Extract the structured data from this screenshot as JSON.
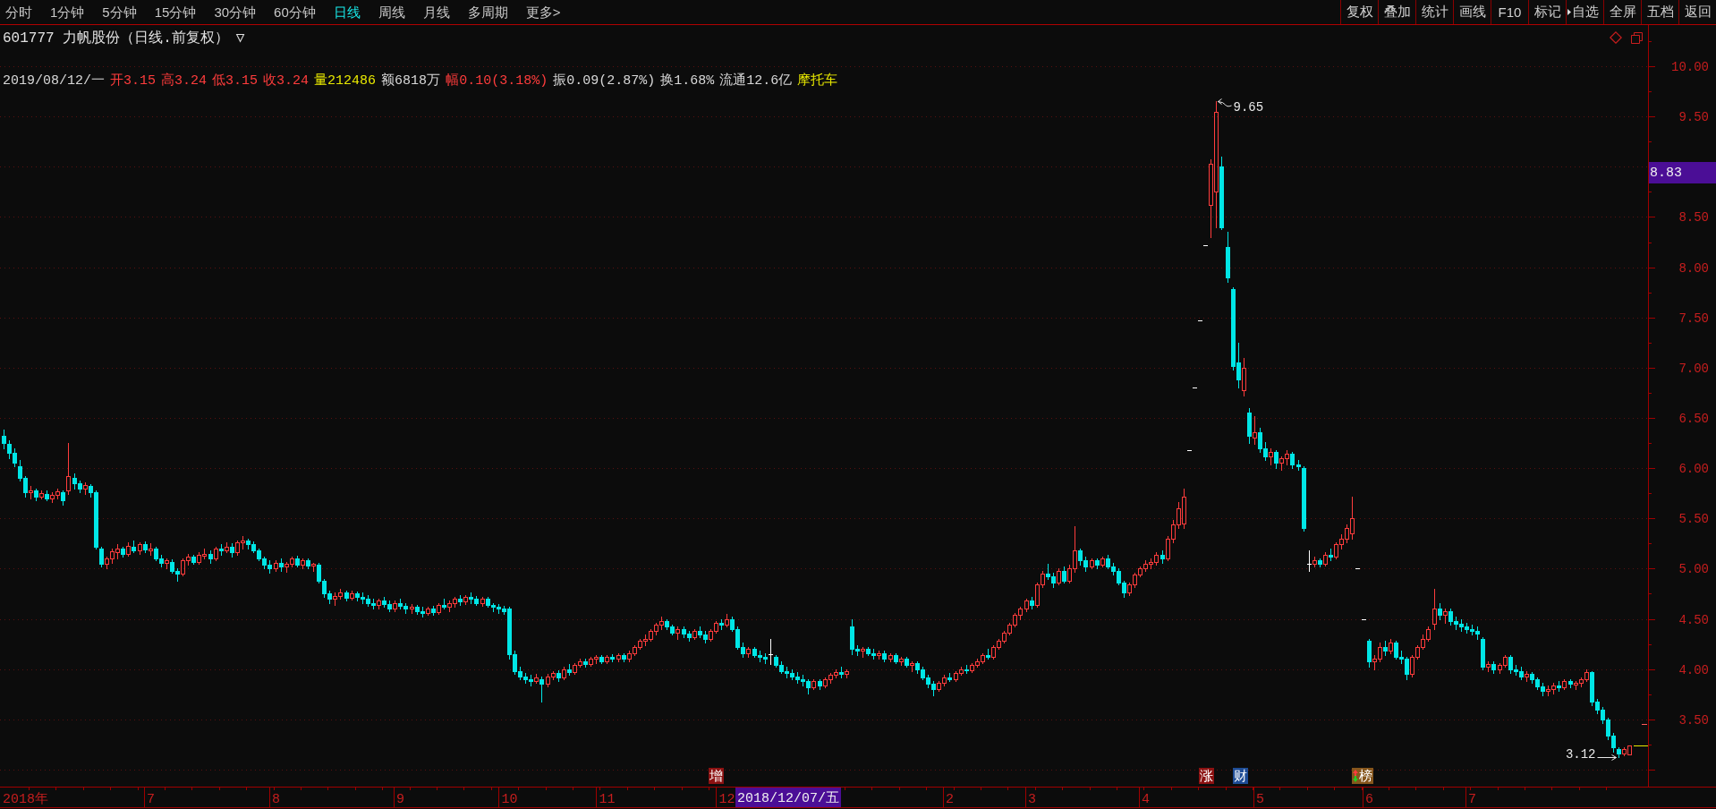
{
  "toolbar": {
    "period_tabs": [
      {
        "label": "分时",
        "selected": false
      },
      {
        "label": "1分钟",
        "selected": false
      },
      {
        "label": "5分钟",
        "selected": false
      },
      {
        "label": "15分钟",
        "selected": false
      },
      {
        "label": "30分钟",
        "selected": false
      },
      {
        "label": "60分钟",
        "selected": false
      },
      {
        "label": "日线",
        "selected": true
      },
      {
        "label": "周线",
        "selected": false
      },
      {
        "label": "月线",
        "selected": false
      },
      {
        "label": "多周期",
        "selected": false
      },
      {
        "label": "更多>",
        "selected": false
      }
    ],
    "buttons": [
      {
        "label": "复权",
        "kind": "plain"
      },
      {
        "label": "叠加",
        "kind": "plain"
      },
      {
        "label": "统计",
        "kind": "plain"
      },
      {
        "label": "画线",
        "kind": "plain"
      },
      {
        "label": "F10",
        "kind": "plain"
      },
      {
        "label": "标记",
        "kind": "plain"
      },
      {
        "label": "自选",
        "kind": "marked"
      },
      {
        "label": "全屏",
        "kind": "plain"
      },
      {
        "label": "五档",
        "kind": "plain"
      },
      {
        "label": "返回",
        "kind": "plain"
      }
    ]
  },
  "header": {
    "title": "601777 力帆股份（日线.前复权）",
    "dropdown": "▽"
  },
  "quote": [
    {
      "text": "2019/08/12/一",
      "color": "#d8d8d8"
    },
    {
      "text": "开3.15",
      "color": "#ff3c3c"
    },
    {
      "text": "高3.24",
      "color": "#ff3c3c"
    },
    {
      "text": "低3.15",
      "color": "#ff3c3c"
    },
    {
      "text": "收3.24",
      "color": "#ff3c3c"
    },
    {
      "text": "量212486",
      "color": "#e8e800"
    },
    {
      "text": "额6818万",
      "color": "#d8d8d8"
    },
    {
      "text": "幅0.10(3.18%)",
      "color": "#ff3c3c"
    },
    {
      "text": "振0.09(2.87%)",
      "color": "#d8d8d8"
    },
    {
      "text": "换1.68%",
      "color": "#d8d8d8"
    },
    {
      "text": "流通12.6亿",
      "color": "#d8d8d8"
    },
    {
      "text": "摩托车",
      "color": "#e8e800"
    }
  ],
  "chart": {
    "high_label": "9.65",
    "low_label": "3.12",
    "price_readout": "8.83",
    "date_readout": "2018/12/07/五",
    "events": [
      {
        "text": "增",
        "kind": "plain",
        "color": "#8c1212"
      },
      {
        "text": "涨",
        "kind": "plain",
        "color": "#8c1212"
      },
      {
        "text": "财",
        "kind": "plain",
        "color": "#1e4c96"
      },
      {
        "text": "榜",
        "kind": "arrows",
        "color": "#86561c"
      }
    ],
    "chart_data": {
      "type": "candlestick",
      "grid": true,
      "ylim": [
        2.83,
        10.41
      ],
      "yticks": [
        {
          "value": 10,
          "label": "10.00"
        },
        {
          "value": 9.5,
          "label": "9.50"
        },
        {
          "value": 8.5,
          "label": "8.50"
        },
        {
          "value": 8,
          "label": "8.00"
        },
        {
          "value": 7.5,
          "label": "7.50"
        },
        {
          "value": 7,
          "label": "7.00"
        },
        {
          "value": 6.5,
          "label": "6.50"
        },
        {
          "value": 6,
          "label": "6.00"
        },
        {
          "value": 5.5,
          "label": "5.50"
        },
        {
          "value": 5,
          "label": "5.00"
        },
        {
          "value": 4.5,
          "label": "4.50"
        },
        {
          "value": 4,
          "label": "4.00"
        },
        {
          "value": 3.5,
          "label": "3.50"
        }
      ],
      "categories": [
        null,
        null,
        null,
        null,
        "2018年",
        null,
        null,
        null,
        null,
        null,
        null,
        null,
        null,
        null,
        null,
        null,
        null,
        null,
        null,
        null,
        null,
        null,
        null,
        null,
        null,
        null,
        null,
        "7",
        null,
        null,
        null,
        null,
        null,
        null,
        null,
        null,
        null,
        null,
        null,
        null,
        null,
        null,
        null,
        null,
        null,
        null,
        null,
        null,
        null,
        null,
        "8",
        null,
        null,
        null,
        null,
        null,
        null,
        null,
        null,
        null,
        null,
        null,
        null,
        null,
        null,
        null,
        null,
        null,
        null,
        null,
        null,
        null,
        null,
        "9",
        null,
        null,
        null,
        null,
        null,
        null,
        null,
        null,
        null,
        null,
        null,
        null,
        null,
        null,
        null,
        null,
        null,
        null,
        null,
        "10",
        null,
        null,
        null,
        null,
        null,
        null,
        null,
        null,
        null,
        null,
        null,
        null,
        null,
        null,
        null,
        null,
        null,
        "11",
        null,
        null,
        null,
        null,
        null,
        null,
        null,
        null,
        null,
        null,
        null,
        null,
        null,
        null,
        null,
        null,
        null,
        null,
        null,
        null,
        null,
        "12",
        null,
        null,
        null,
        null,
        null,
        null,
        null,
        null,
        null,
        null,
        null,
        null,
        null,
        null,
        null,
        null,
        null,
        null,
        null,
        null,
        null,
        null,
        null,
        null,
        null,
        null,
        null,
        null,
        null,
        null,
        null,
        null,
        null,
        null,
        null,
        null,
        null,
        null,
        null,
        null,
        "2",
        null,
        null,
        null,
        null,
        null,
        null,
        null,
        null,
        null,
        null,
        null,
        null,
        null,
        null,
        "3",
        null,
        null,
        null,
        null,
        null,
        null,
        null,
        null,
        null,
        null,
        null,
        null,
        null,
        null,
        null,
        null,
        null,
        null,
        null,
        null,
        "4",
        null,
        null,
        null,
        null,
        null,
        null,
        null,
        null,
        null,
        null,
        null,
        null,
        null,
        null,
        null,
        null,
        null,
        null,
        null,
        null,
        "5",
        null,
        null,
        null,
        null,
        null,
        null,
        null,
        null,
        null,
        null,
        null,
        null,
        null,
        null,
        null,
        null,
        null,
        null,
        null,
        "6",
        null,
        null,
        null,
        null,
        null,
        null,
        null,
        null,
        null,
        null,
        null,
        null,
        null,
        null,
        null,
        null,
        null,
        null,
        "7",
        null,
        null,
        null,
        null,
        null,
        null,
        null,
        null,
        null,
        null,
        null,
        null,
        null,
        null,
        null,
        null,
        null,
        null,
        null,
        null,
        null,
        null,
        null,
        null,
        null,
        null,
        null,
        null,
        null
      ],
      "ohlc": [
        [
          6.32,
          6.38,
          6.2,
          6.25
        ],
        [
          6.24,
          6.28,
          6.1,
          6.15
        ],
        [
          6.15,
          6.2,
          6.02,
          6.05
        ],
        [
          6.02,
          6.08,
          5.88,
          5.9
        ],
        [
          5.9,
          5.92,
          5.72,
          5.76
        ],
        [
          5.76,
          5.82,
          5.7,
          5.78
        ],
        [
          5.78,
          5.8,
          5.68,
          5.72
        ],
        [
          5.72,
          5.78,
          5.7,
          5.75
        ],
        [
          5.74,
          5.78,
          5.68,
          5.7
        ],
        [
          5.7,
          5.76,
          5.66,
          5.73
        ],
        [
          5.73,
          5.8,
          5.7,
          5.77
        ],
        [
          5.76,
          5.78,
          5.64,
          5.68
        ],
        [
          5.78,
          6.25,
          5.74,
          5.92
        ],
        [
          5.9,
          5.95,
          5.8,
          5.85
        ],
        [
          5.85,
          5.88,
          5.76,
          5.8
        ],
        [
          5.8,
          5.86,
          5.74,
          5.83
        ],
        [
          5.82,
          5.84,
          5.72,
          5.76
        ],
        [
          5.76,
          5.78,
          5.2,
          5.22
        ],
        [
          5.2,
          5.22,
          5.02,
          5.05
        ],
        [
          5.05,
          5.12,
          5.0,
          5.1
        ],
        [
          5.1,
          5.2,
          5.06,
          5.17
        ],
        [
          5.16,
          5.24,
          5.1,
          5.2
        ],
        [
          5.2,
          5.22,
          5.12,
          5.15
        ],
        [
          5.15,
          5.26,
          5.13,
          5.23
        ],
        [
          5.22,
          5.28,
          5.16,
          5.18
        ],
        [
          5.18,
          5.26,
          5.15,
          5.24
        ],
        [
          5.24,
          5.27,
          5.16,
          5.19
        ],
        [
          5.19,
          5.25,
          5.14,
          5.2
        ],
        [
          5.2,
          5.22,
          5.08,
          5.1
        ],
        [
          5.1,
          5.14,
          5.02,
          5.06
        ],
        [
          5.06,
          5.1,
          5.0,
          5.08
        ],
        [
          5.07,
          5.09,
          4.96,
          4.98
        ],
        [
          4.98,
          5.0,
          4.88,
          4.95
        ],
        [
          4.95,
          5.1,
          4.93,
          5.08
        ],
        [
          5.08,
          5.15,
          5.04,
          5.12
        ],
        [
          5.12,
          5.14,
          5.05,
          5.07
        ],
        [
          5.07,
          5.16,
          5.05,
          5.14
        ],
        [
          5.14,
          5.2,
          5.1,
          5.15
        ],
        [
          5.15,
          5.18,
          5.06,
          5.1
        ],
        [
          5.1,
          5.22,
          5.08,
          5.2
        ],
        [
          5.2,
          5.24,
          5.14,
          5.18
        ],
        [
          5.18,
          5.26,
          5.16,
          5.22
        ],
        [
          5.22,
          5.25,
          5.12,
          5.16
        ],
        [
          5.16,
          5.28,
          5.14,
          5.26
        ],
        [
          5.26,
          5.32,
          5.2,
          5.28
        ],
        [
          5.28,
          5.3,
          5.2,
          5.24
        ],
        [
          5.24,
          5.27,
          5.16,
          5.18
        ],
        [
          5.18,
          5.2,
          5.08,
          5.1
        ],
        [
          5.1,
          5.12,
          5.0,
          5.04
        ],
        [
          5.04,
          5.08,
          4.96,
          5.0
        ],
        [
          5.0,
          5.08,
          4.98,
          5.06
        ],
        [
          5.06,
          5.1,
          4.98,
          5.02
        ],
        [
          5.02,
          5.07,
          4.97,
          5.05
        ],
        [
          5.05,
          5.12,
          5.02,
          5.1
        ],
        [
          5.1,
          5.13,
          5.02,
          5.04
        ],
        [
          5.04,
          5.1,
          5.0,
          5.08
        ],
        [
          5.08,
          5.1,
          5.0,
          5.03
        ],
        [
          5.03,
          5.06,
          4.98,
          5.05
        ],
        [
          5.04,
          5.06,
          4.86,
          4.88
        ],
        [
          4.88,
          4.9,
          4.72,
          4.75
        ],
        [
          4.75,
          4.78,
          4.66,
          4.7
        ],
        [
          4.7,
          4.76,
          4.64,
          4.73
        ],
        [
          4.73,
          4.8,
          4.7,
          4.76
        ],
        [
          4.76,
          4.78,
          4.68,
          4.71
        ],
        [
          4.71,
          4.78,
          4.69,
          4.75
        ],
        [
          4.75,
          4.77,
          4.68,
          4.72
        ],
        [
          4.72,
          4.76,
          4.66,
          4.7
        ],
        [
          4.7,
          4.74,
          4.63,
          4.66
        ],
        [
          4.66,
          4.7,
          4.6,
          4.64
        ],
        [
          4.64,
          4.7,
          4.6,
          4.68
        ],
        [
          4.68,
          4.72,
          4.62,
          4.65
        ],
        [
          4.65,
          4.68,
          4.58,
          4.6
        ],
        [
          4.6,
          4.68,
          4.58,
          4.66
        ],
        [
          4.66,
          4.7,
          4.6,
          4.63
        ],
        [
          4.63,
          4.66,
          4.56,
          4.6
        ],
        [
          4.6,
          4.65,
          4.56,
          4.62
        ],
        [
          4.62,
          4.64,
          4.55,
          4.58
        ],
        [
          4.58,
          4.62,
          4.52,
          4.56
        ],
        [
          4.56,
          4.62,
          4.54,
          4.6
        ],
        [
          4.6,
          4.63,
          4.54,
          4.57
        ],
        [
          4.57,
          4.66,
          4.55,
          4.64
        ],
        [
          4.64,
          4.7,
          4.6,
          4.62
        ],
        [
          4.62,
          4.68,
          4.58,
          4.66
        ],
        [
          4.66,
          4.72,
          4.62,
          4.7
        ],
        [
          4.7,
          4.74,
          4.64,
          4.67
        ],
        [
          4.67,
          4.74,
          4.65,
          4.72
        ],
        [
          4.72,
          4.76,
          4.66,
          4.7
        ],
        [
          4.7,
          4.73,
          4.64,
          4.66
        ],
        [
          4.66,
          4.72,
          4.63,
          4.7
        ],
        [
          4.7,
          4.72,
          4.62,
          4.64
        ],
        [
          4.64,
          4.66,
          4.58,
          4.62
        ],
        [
          4.62,
          4.65,
          4.56,
          4.6
        ],
        [
          4.6,
          4.63,
          4.55,
          4.58
        ],
        [
          4.6,
          4.62,
          4.1,
          4.15
        ],
        [
          4.15,
          4.18,
          3.95,
          3.98
        ],
        [
          3.98,
          4.02,
          3.9,
          3.93
        ],
        [
          3.93,
          3.96,
          3.86,
          3.9
        ],
        [
          3.9,
          3.94,
          3.84,
          3.88
        ],
        [
          3.88,
          3.95,
          3.86,
          3.92
        ],
        [
          3.9,
          3.93,
          3.68,
          3.85
        ],
        [
          3.85,
          3.95,
          3.83,
          3.93
        ],
        [
          3.93,
          3.98,
          3.9,
          3.96
        ],
        [
          3.96,
          3.99,
          3.88,
          3.92
        ],
        [
          3.92,
          4.02,
          3.9,
          4.0
        ],
        [
          4.0,
          4.05,
          3.94,
          3.97
        ],
        [
          3.97,
          4.06,
          3.95,
          4.04
        ],
        [
          4.04,
          4.1,
          4.02,
          4.08
        ],
        [
          4.08,
          4.1,
          4.02,
          4.05
        ],
        [
          4.05,
          4.12,
          4.03,
          4.1
        ],
        [
          4.1,
          4.14,
          4.06,
          4.12
        ],
        [
          4.12,
          4.14,
          4.06,
          4.08
        ],
        [
          4.08,
          4.14,
          4.06,
          4.12
        ],
        [
          4.12,
          4.15,
          4.08,
          4.1
        ],
        [
          4.1,
          4.16,
          4.08,
          4.14
        ],
        [
          4.14,
          4.16,
          4.08,
          4.1
        ],
        [
          4.1,
          4.18,
          4.08,
          4.16
        ],
        [
          4.16,
          4.24,
          4.14,
          4.22
        ],
        [
          4.22,
          4.3,
          4.2,
          4.28
        ],
        [
          4.28,
          4.34,
          4.24,
          4.3
        ],
        [
          4.3,
          4.4,
          4.28,
          4.38
        ],
        [
          4.38,
          4.46,
          4.34,
          4.44
        ],
        [
          4.44,
          4.52,
          4.4,
          4.48
        ],
        [
          4.48,
          4.5,
          4.4,
          4.42
        ],
        [
          4.42,
          4.44,
          4.34,
          4.36
        ],
        [
          4.36,
          4.42,
          4.3,
          4.4
        ],
        [
          4.4,
          4.42,
          4.32,
          4.35
        ],
        [
          4.35,
          4.38,
          4.28,
          4.32
        ],
        [
          4.32,
          4.4,
          4.3,
          4.38
        ],
        [
          4.38,
          4.42,
          4.32,
          4.34
        ],
        [
          4.34,
          4.38,
          4.26,
          4.3
        ],
        [
          4.3,
          4.4,
          4.28,
          4.38
        ],
        [
          4.38,
          4.48,
          4.36,
          4.46
        ],
        [
          4.46,
          4.5,
          4.4,
          4.44
        ],
        [
          4.44,
          4.55,
          4.42,
          4.5
        ],
        [
          4.5,
          4.52,
          4.38,
          4.4
        ],
        [
          4.4,
          4.42,
          4.2,
          4.22
        ],
        [
          4.22,
          4.26,
          4.12,
          4.16
        ],
        [
          4.16,
          4.22,
          4.12,
          4.2
        ],
        [
          4.2,
          4.22,
          4.12,
          4.14
        ],
        [
          4.14,
          4.18,
          4.08,
          4.12
        ],
        [
          4.12,
          4.16,
          4.06,
          4.1
        ],
        [
          4.15,
          4.3,
          4.05,
          4.15
        ],
        [
          4.12,
          4.14,
          4.02,
          4.04
        ],
        [
          4.04,
          4.08,
          3.96,
          3.98
        ],
        [
          3.98,
          4.02,
          3.92,
          3.96
        ],
        [
          3.96,
          4.0,
          3.9,
          3.93
        ],
        [
          3.93,
          3.97,
          3.86,
          3.9
        ],
        [
          3.9,
          3.94,
          3.84,
          3.88
        ],
        [
          3.88,
          3.9,
          3.76,
          3.82
        ],
        [
          3.82,
          3.9,
          3.8,
          3.88
        ],
        [
          3.88,
          3.9,
          3.8,
          3.84
        ],
        [
          3.84,
          3.92,
          3.82,
          3.9
        ],
        [
          3.9,
          3.96,
          3.86,
          3.94
        ],
        [
          3.94,
          4.0,
          3.92,
          3.97
        ],
        [
          3.97,
          4.02,
          3.92,
          3.95
        ],
        [
          3.95,
          4.0,
          3.92,
          3.98
        ],
        [
          4.42,
          4.5,
          4.15,
          4.2
        ],
        [
          4.2,
          4.24,
          4.14,
          4.18
        ],
        [
          4.18,
          4.22,
          4.12,
          4.2
        ],
        [
          4.2,
          4.22,
          4.14,
          4.16
        ],
        [
          4.16,
          4.2,
          4.1,
          4.14
        ],
        [
          4.14,
          4.18,
          4.1,
          4.16
        ],
        [
          4.16,
          4.18,
          4.08,
          4.1
        ],
        [
          4.1,
          4.16,
          4.08,
          4.14
        ],
        [
          4.14,
          4.16,
          4.06,
          4.08
        ],
        [
          4.08,
          4.12,
          4.04,
          4.1
        ],
        [
          4.1,
          4.12,
          4.02,
          4.04
        ],
        [
          4.04,
          4.08,
          3.98,
          4.06
        ],
        [
          4.06,
          4.08,
          3.96,
          4.0
        ],
        [
          4.0,
          4.02,
          3.9,
          3.92
        ],
        [
          3.92,
          3.94,
          3.82,
          3.85
        ],
        [
          3.85,
          3.88,
          3.74,
          3.8
        ],
        [
          3.8,
          3.88,
          3.78,
          3.86
        ],
        [
          3.86,
          3.94,
          3.84,
          3.92
        ],
        [
          3.92,
          3.96,
          3.88,
          3.9
        ],
        [
          3.9,
          3.98,
          3.88,
          3.96
        ],
        [
          3.96,
          4.02,
          3.94,
          4.0
        ],
        [
          4.0,
          4.04,
          3.96,
          3.99
        ],
        [
          3.99,
          4.06,
          3.97,
          4.04
        ],
        [
          4.04,
          4.1,
          4.02,
          4.08
        ],
        [
          4.08,
          4.16,
          4.06,
          4.14
        ],
        [
          4.14,
          4.2,
          4.1,
          4.12
        ],
        [
          4.12,
          4.24,
          4.1,
          4.22
        ],
        [
          4.22,
          4.3,
          4.2,
          4.28
        ],
        [
          4.28,
          4.38,
          4.26,
          4.36
        ],
        [
          4.36,
          4.46,
          4.34,
          4.44
        ],
        [
          4.44,
          4.56,
          4.42,
          4.54
        ],
        [
          4.54,
          4.62,
          4.5,
          4.6
        ],
        [
          4.6,
          4.7,
          4.58,
          4.68
        ],
        [
          4.68,
          4.72,
          4.6,
          4.64
        ],
        [
          4.64,
          4.86,
          4.62,
          4.84
        ],
        [
          4.84,
          4.98,
          4.82,
          4.95
        ],
        [
          4.95,
          5.05,
          4.9,
          4.92
        ],
        [
          4.92,
          4.96,
          4.82,
          4.86
        ],
        [
          4.86,
          5.0,
          4.84,
          4.98
        ],
        [
          4.98,
          5.02,
          4.86,
          4.88
        ],
        [
          4.88,
          5.04,
          4.86,
          5.0
        ],
        [
          5.0,
          5.42,
          4.97,
          5.18
        ],
        [
          5.18,
          5.2,
          5.04,
          5.08
        ],
        [
          5.08,
          5.12,
          4.98,
          5.02
        ],
        [
          5.02,
          5.1,
          5.0,
          5.08
        ],
        [
          5.08,
          5.1,
          5.0,
          5.04
        ],
        [
          5.04,
          5.12,
          5.02,
          5.1
        ],
        [
          5.1,
          5.14,
          5.0,
          5.02
        ],
        [
          5.02,
          5.06,
          4.94,
          4.98
        ],
        [
          4.98,
          5.0,
          4.84,
          4.86
        ],
        [
          4.86,
          4.88,
          4.72,
          4.76
        ],
        [
          4.76,
          4.86,
          4.74,
          4.84
        ],
        [
          4.84,
          4.96,
          4.82,
          4.94
        ],
        [
          4.94,
          5.02,
          4.92,
          5.0
        ],
        [
          5.0,
          5.08,
          4.98,
          5.05
        ],
        [
          5.05,
          5.1,
          5.0,
          5.07
        ],
        [
          5.07,
          5.16,
          5.04,
          5.14
        ],
        [
          5.14,
          5.18,
          5.06,
          5.1
        ],
        [
          5.1,
          5.32,
          5.08,
          5.3
        ],
        [
          5.3,
          5.48,
          5.26,
          5.44
        ],
        [
          5.44,
          5.66,
          5.4,
          5.6
        ],
        [
          5.45,
          5.8,
          5.4,
          5.72
        ],
        [
          6.18,
          6.18,
          6.18,
          6.18
        ],
        [
          6.8,
          6.8,
          6.8,
          6.8
        ],
        [
          7.47,
          7.47,
          7.47,
          7.47
        ],
        [
          8.22,
          8.22,
          8.22,
          8.22
        ],
        [
          8.62,
          9.07,
          8.3,
          9.03
        ],
        [
          8.75,
          9.65,
          8.4,
          9.55
        ],
        [
          9.0,
          9.1,
          8.38,
          8.4
        ],
        [
          8.2,
          8.35,
          7.85,
          7.9
        ],
        [
          7.78,
          7.8,
          6.98,
          7.02
        ],
        [
          7.05,
          7.25,
          6.8,
          6.88
        ],
        [
          6.78,
          7.1,
          6.72,
          7.0
        ],
        [
          6.55,
          6.6,
          6.25,
          6.32
        ],
        [
          6.3,
          6.52,
          6.24,
          6.36
        ],
        [
          6.36,
          6.4,
          6.16,
          6.2
        ],
        [
          6.2,
          6.26,
          6.08,
          6.12
        ],
        [
          6.12,
          6.2,
          6.04,
          6.16
        ],
        [
          6.16,
          6.18,
          6.0,
          6.05
        ],
        [
          6.05,
          6.12,
          5.98,
          6.1
        ],
        [
          6.1,
          6.18,
          6.04,
          6.14
        ],
        [
          6.14,
          6.16,
          6.0,
          6.04
        ],
        [
          6.04,
          6.08,
          5.98,
          6.02
        ],
        [
          6.0,
          6.02,
          5.38,
          5.4
        ],
        [
          5.05,
          5.18,
          4.98,
          5.05
        ],
        [
          5.05,
          5.12,
          5.02,
          5.08
        ],
        [
          5.08,
          5.1,
          5.02,
          5.05
        ],
        [
          5.05,
          5.16,
          5.03,
          5.14
        ],
        [
          5.14,
          5.2,
          5.08,
          5.12
        ],
        [
          5.12,
          5.26,
          5.1,
          5.24
        ],
        [
          5.24,
          5.34,
          5.2,
          5.3
        ],
        [
          5.3,
          5.44,
          5.26,
          5.4
        ],
        [
          5.35,
          5.72,
          5.3,
          5.5
        ],
        [
          5.0,
          5.0,
          5.0,
          5.0
        ],
        [
          4.5,
          4.5,
          4.5,
          4.5
        ],
        [
          4.28,
          4.3,
          4.02,
          4.08
        ],
        [
          4.08,
          4.14,
          4.0,
          4.1
        ],
        [
          4.1,
          4.26,
          4.08,
          4.22
        ],
        [
          4.22,
          4.28,
          4.14,
          4.18
        ],
        [
          4.18,
          4.3,
          4.16,
          4.26
        ],
        [
          4.26,
          4.28,
          4.1,
          4.12
        ],
        [
          4.12,
          4.18,
          4.06,
          4.1
        ],
        [
          4.1,
          4.12,
          3.9,
          3.95
        ],
        [
          3.95,
          4.14,
          3.93,
          4.12
        ],
        [
          4.12,
          4.24,
          4.1,
          4.22
        ],
        [
          4.22,
          4.34,
          4.2,
          4.3
        ],
        [
          4.3,
          4.42,
          4.28,
          4.4
        ],
        [
          4.45,
          4.8,
          4.4,
          4.6
        ],
        [
          4.6,
          4.66,
          4.5,
          4.54
        ],
        [
          4.54,
          4.6,
          4.46,
          4.58
        ],
        [
          4.58,
          4.6,
          4.44,
          4.48
        ],
        [
          4.48,
          4.52,
          4.4,
          4.45
        ],
        [
          4.45,
          4.5,
          4.38,
          4.42
        ],
        [
          4.42,
          4.46,
          4.36,
          4.4
        ],
        [
          4.4,
          4.44,
          4.34,
          4.38
        ],
        [
          4.38,
          4.42,
          4.3,
          4.35
        ],
        [
          4.3,
          4.32,
          4.0,
          4.02
        ],
        [
          4.02,
          4.08,
          3.98,
          4.05
        ],
        [
          4.05,
          4.08,
          3.96,
          4.0
        ],
        [
          4.0,
          4.06,
          3.96,
          4.04
        ],
        [
          4.04,
          4.14,
          4.02,
          4.12
        ],
        [
          4.12,
          4.14,
          3.96,
          4.0
        ],
        [
          4.0,
          4.04,
          3.94,
          3.98
        ],
        [
          3.98,
          4.02,
          3.9,
          3.93
        ],
        [
          3.93,
          3.98,
          3.88,
          3.95
        ],
        [
          3.95,
          3.97,
          3.86,
          3.9
        ],
        [
          3.9,
          3.92,
          3.8,
          3.83
        ],
        [
          3.83,
          3.86,
          3.74,
          3.78
        ],
        [
          3.78,
          3.84,
          3.74,
          3.8
        ],
        [
          3.8,
          3.86,
          3.76,
          3.84
        ],
        [
          3.84,
          3.88,
          3.78,
          3.82
        ],
        [
          3.82,
          3.9,
          3.8,
          3.88
        ],
        [
          3.88,
          3.9,
          3.82,
          3.85
        ],
        [
          3.85,
          3.88,
          3.8,
          3.86
        ],
        [
          3.86,
          3.92,
          3.83,
          3.9
        ],
        [
          3.9,
          4.0,
          3.88,
          3.97
        ],
        [
          3.97,
          3.98,
          3.64,
          3.68
        ],
        [
          3.68,
          3.7,
          3.56,
          3.6
        ],
        [
          3.6,
          3.62,
          3.46,
          3.5
        ],
        [
          3.5,
          3.52,
          3.3,
          3.34
        ],
        [
          3.34,
          3.36,
          3.18,
          3.22
        ],
        [
          3.2,
          3.22,
          3.12,
          3.16
        ],
        [
          3.16,
          3.22,
          3.14,
          3.2
        ],
        [
          3.15,
          3.24,
          3.15,
          3.24
        ]
      ]
    }
  }
}
